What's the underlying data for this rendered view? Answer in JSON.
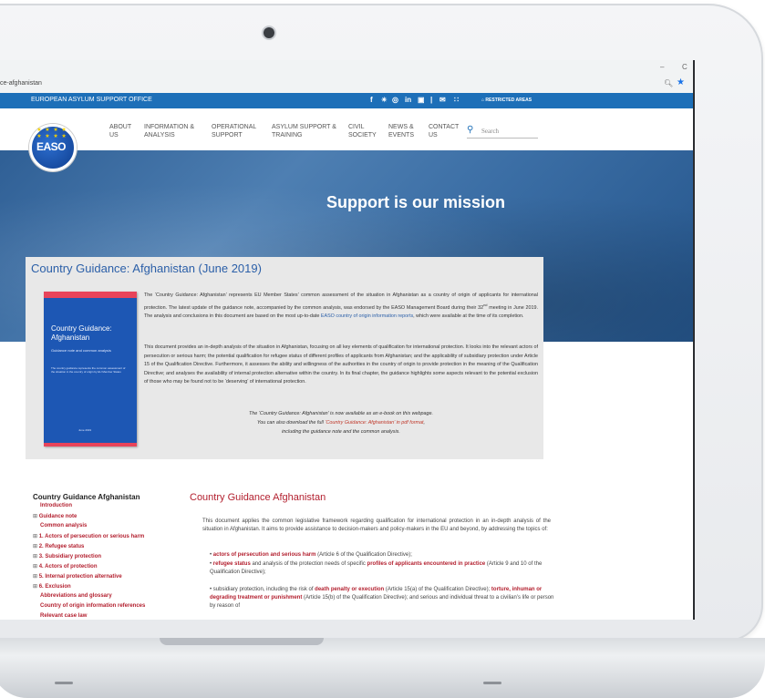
{
  "browser": {
    "url": "ce-afghanistan",
    "minimize": "–",
    "restore": "C",
    "zoom_icon": "zoom-icon",
    "bookmark_icon": "star-icon"
  },
  "topbar": {
    "office_name": "EUROPEAN ASYLUM SUPPORT OFFICE",
    "social": [
      "f",
      "—",
      "◎",
      "in",
      "▣",
      "|",
      "✉",
      "Ⅱ"
    ],
    "restricted": "⌂ RESTRICTED AREAS"
  },
  "logo": {
    "text": "EASO",
    "stars": "★ ★ ★ ★ ★ ★ ★ ★"
  },
  "nav": {
    "items": [
      {
        "line1": "ABOUT",
        "line2": "US"
      },
      {
        "line1": "INFORMATION &",
        "line2": "ANALYSIS"
      },
      {
        "line1": "OPERATIONAL",
        "line2": "SUPPORT"
      },
      {
        "line1": "ASYLUM SUPPORT &",
        "line2": "TRAINING"
      },
      {
        "line1": "CIVIL",
        "line2": "SOCIETY"
      },
      {
        "line1": "NEWS &",
        "line2": "EVENTS"
      },
      {
        "line1": "CONTACT",
        "line2": "US"
      }
    ],
    "search_placeholder": "Search"
  },
  "hero": {
    "title": "Support is our mission"
  },
  "guidance": {
    "title": "Country Guidance: Afghanistan (June 2019)",
    "cover_title_1": "Country Guidance:",
    "cover_title_2": "Afghanistan",
    "cover_sub": "Guidance note and common analysis",
    "cover_body": "The country guidance represents the common assessment of the situation in the country of origin by EU Member States",
    "cover_date": "June 2019",
    "p1_a": "The ‘Country Guidance: Afghanistan’ represents EU Member States’ common assessment of the situation in Afghanistan as a country of origin of applicants for international protection. The latest update of the guidance note, accompanied by the common analysis, was endorsed by the EASO Management Board during their 32",
    "p1_sup": "nd",
    "p1_b": " meeting in June 2019. The analysis and conclusions in this document are based on the most up-to-date ",
    "p1_link": "EASO country of origin information reports",
    "p1_c": ", which were available at the time of its completion.",
    "p2": "This document provides an in-depth analysis of the situation in Afghanistan, focusing on all key elements of qualification for international protection. It looks into the relevant actors of persecution or serious harm; the potential qualification for refugee status of different profiles of applicants from Afghanistan; and the applicability of subsidiary protection under Article 15 of the Qualification Directive. Furthermore, it assesses the ability and willingness of the authorities in the country of origin to provide protection in the meaning of the Qualification Directive; and analyses the availability of internal protection alternative within the country. In its final chapter, the guidance highlights some aspects relevant to the potential exclusion of those who may be found not to be ‘deserving’ of international protection.",
    "c1": "The ‘Country Guidance: Afghanistan’ is now available as an e-book on this webpage.",
    "c2_a": "You can also download the full ",
    "c2_link": "‘Country Guidance: Afghanistan’ in pdf format",
    "c2_b": ",",
    "c3": "including the guidance note and the common analysis."
  },
  "sidebar": {
    "title": "Country Guidance Afghanistan",
    "items": [
      {
        "prefix": "",
        "label": "Introduction"
      },
      {
        "prefix": "⊞ ",
        "label": "Guidance note"
      },
      {
        "prefix": "",
        "label": "Common analysis"
      },
      {
        "prefix": "⊞ ",
        "label": "1. Actors of persecution or serious harm"
      },
      {
        "prefix": "⊞ ",
        "label": "2. Refugee status"
      },
      {
        "prefix": "⊞ ",
        "label": "3. Subsidiary protection"
      },
      {
        "prefix": "⊞ ",
        "label": "4. Actors of protection"
      },
      {
        "prefix": "⊞ ",
        "label": "5. Internal protection alternative"
      },
      {
        "prefix": "⊞ ",
        "label": "6. Exclusion"
      },
      {
        "prefix": "",
        "label": "Abbreviations and glossary"
      },
      {
        "prefix": "",
        "label": "Country of origin information references"
      },
      {
        "prefix": "",
        "label": "Relevant case law"
      }
    ]
  },
  "main": {
    "title": "Country Guidance Afghanistan",
    "intro": "This document applies the common legislative framework regarding qualification for international protection in an in-depth analysis of the situation in Afghanistan. It aims to provide assistance to decision-makers and policy-makers in the EU and beyond, by addressing the topics of:",
    "b1_bold": "actors of persecution and serious harm",
    "b1_rest": " (Article 6 of the Qualification Directive);",
    "b2_bold": "refugee status",
    "b2_mid": " and analysis of the protection needs of specific ",
    "b2_bold2": "profiles of applicants encountered in practice",
    "b2_rest": " (Article 9 and 10 of the Qualification Directive);",
    "b3_a": "subsidiary protection, including the risk of ",
    "b3_bold": "death penalty or execution",
    "b3_b": " (Article 15(a) of the Qualification Directive); ",
    "b3_bold2": "torture, inhuman or degrading treatment or punishment",
    "b3_c": " (Article 15(b) of the Qualification Directive); and serious and individual threat to a civilian’s life or person by reason of"
  }
}
